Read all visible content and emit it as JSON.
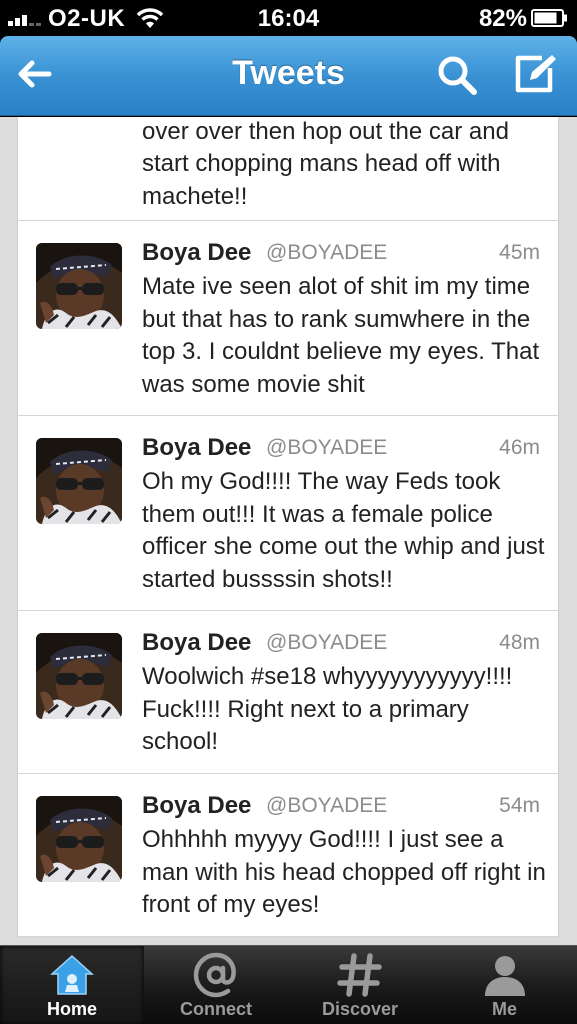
{
  "status_bar": {
    "carrier": "O2-UK",
    "time": "16:04",
    "battery": "82%"
  },
  "nav": {
    "title": "Tweets"
  },
  "tweets": [
    {
      "name": "",
      "handle": "",
      "time": "",
      "text": "just drove into this young white guy over over then hop out the car and start chopping mans head off with machete!!"
    },
    {
      "name": "Boya Dee",
      "handle": "@BOYADEE",
      "time": "45m",
      "text": "Mate ive seen alot of shit im my time but that has to rank sumwhere in the top 3. I couldnt believe my eyes. That was some movie shit"
    },
    {
      "name": "Boya Dee",
      "handle": "@BOYADEE",
      "time": "46m",
      "text": "Oh my God!!!! The way Feds took them out!!! It was a female police officer she come out the whip and just started bussssin shots!!"
    },
    {
      "name": "Boya Dee",
      "handle": "@BOYADEE",
      "time": "48m",
      "text": "Woolwich #se18 whyyyyyyyyyyy!!!! Fuck!!!! Right next to a primary school!"
    },
    {
      "name": "Boya Dee",
      "handle": "@BOYADEE",
      "time": "54m",
      "text": "Ohhhhh myyyy God!!!! I just see a man with his  head chopped off right in front of my eyes!"
    }
  ],
  "tabs": [
    {
      "label": "Home",
      "icon": "home-icon",
      "active": true
    },
    {
      "label": "Connect",
      "icon": "at-icon",
      "active": false
    },
    {
      "label": "Discover",
      "icon": "hashtag-icon",
      "active": false
    },
    {
      "label": "Me",
      "icon": "person-icon",
      "active": false
    }
  ],
  "colors": {
    "nav_blue": "#3a92d4",
    "tab_active_icon": "#3aa0e8"
  }
}
